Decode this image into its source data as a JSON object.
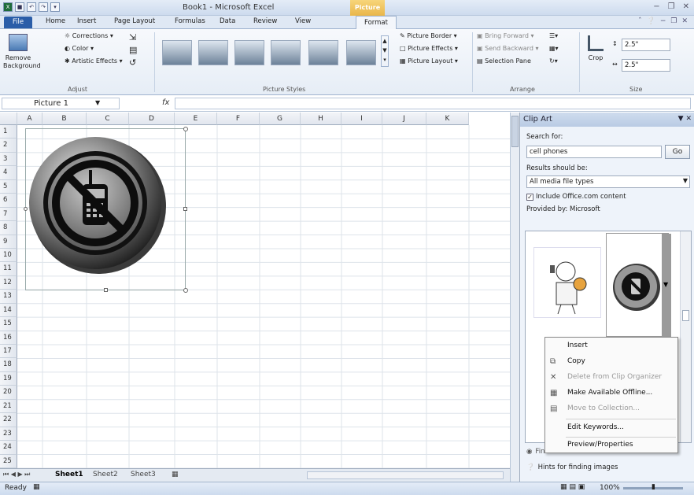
{
  "window": {
    "title": "Book1 - Microsoft Excel",
    "context_tab_group": "Picture Tools",
    "controls": [
      "−",
      "❐",
      "✕"
    ]
  },
  "tabs": [
    {
      "label": "File"
    },
    {
      "label": "Home"
    },
    {
      "label": "Insert"
    },
    {
      "label": "Page Layout"
    },
    {
      "label": "Formulas"
    },
    {
      "label": "Data"
    },
    {
      "label": "Review"
    },
    {
      "label": "View"
    },
    {
      "label": "Format"
    }
  ],
  "ribbon": {
    "adjust": {
      "remove_bg": "Remove Background",
      "corrections": "Corrections",
      "color": "Color",
      "artistic": "Artistic Effects",
      "label": "Adjust"
    },
    "styles": {
      "label": "Picture Styles",
      "border": "Picture Border",
      "effects": "Picture Effects",
      "layout": "Picture Layout"
    },
    "arrange": {
      "label": "Arrange",
      "bring_forward": "Bring Forward",
      "send_backward": "Send Backward",
      "selection_pane": "Selection Pane"
    },
    "size": {
      "label": "Size",
      "crop": "Crop",
      "height": "2.5\"",
      "width": "2.5\""
    }
  },
  "formula_bar": {
    "name_box": "Picture 1",
    "fx": "fx",
    "value": ""
  },
  "grid": {
    "columns": [
      "A",
      "B",
      "C",
      "D",
      "E",
      "F",
      "G",
      "H",
      "I",
      "J",
      "K"
    ],
    "rows": [
      "1",
      "2",
      "3",
      "4",
      "5",
      "6",
      "7",
      "8",
      "9",
      "10",
      "11",
      "12",
      "13",
      "14",
      "15",
      "16",
      "17",
      "18",
      "19",
      "20",
      "21",
      "22",
      "23",
      "24",
      "25"
    ]
  },
  "sheet_tabs": [
    "Sheet1",
    "Sheet2",
    "Sheet3"
  ],
  "status": {
    "ready": "Ready",
    "zoom": "100%"
  },
  "clip_art": {
    "title": "Clip Art",
    "search_for_label": "Search for:",
    "search_value": "cell phones",
    "go": "Go",
    "results_label": "Results should be:",
    "results_value": "All media file types",
    "include_office": "Include Office.com content",
    "provided_by": "Provided by:  Microsoft",
    "find_more": "Find more at Office.com",
    "hints": "Hints for finding images"
  },
  "context_menu": [
    {
      "label": "Insert",
      "enabled": true
    },
    {
      "label": "Copy",
      "enabled": true
    },
    {
      "label": "Delete from Clip Organizer",
      "enabled": false
    },
    {
      "label": "Make Available Offline...",
      "enabled": true
    },
    {
      "label": "Move to Collection...",
      "enabled": false
    },
    {
      "label": "Edit Keywords...",
      "enabled": true
    },
    {
      "label": "Preview/Properties",
      "enabled": true
    }
  ]
}
